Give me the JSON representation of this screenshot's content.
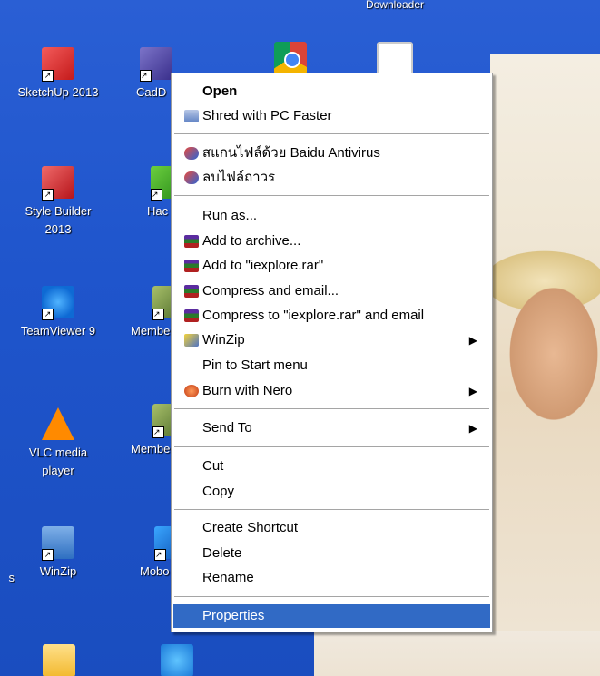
{
  "desktop": {
    "top_label": "Downloader",
    "icons": [
      {
        "label": "SketchUp 2013"
      },
      {
        "label": "CadD"
      },
      {
        "label": "Style Builder 2013"
      },
      {
        "label": "Hac"
      },
      {
        "label": "TeamViewer 9"
      },
      {
        "label": "Membe"
      },
      {
        "label": "VLC media player"
      },
      {
        "label": "Membe"
      },
      {
        "label": "WinZip"
      },
      {
        "label": "Mobo"
      },
      {
        "label": "s"
      }
    ]
  },
  "context_menu": {
    "items": [
      {
        "label": "Open",
        "icon": "none"
      },
      {
        "label": "Shred with PC Faster",
        "icon": "shred-icon"
      },
      {
        "label": "สแกนไฟล์ด้วย Baidu Antivirus",
        "icon": "baidu-antivirus-icon"
      },
      {
        "label": "ลบไฟล์ถาวร",
        "icon": "baidu-antivirus-icon"
      },
      {
        "label": "Run as...",
        "icon": "none"
      },
      {
        "label": "Add to archive...",
        "icon": "winrar-icon"
      },
      {
        "label": "Add to \"iexplore.rar\"",
        "icon": "winrar-icon"
      },
      {
        "label": "Compress and email...",
        "icon": "winrar-icon"
      },
      {
        "label": "Compress to \"iexplore.rar\" and email",
        "icon": "winrar-icon"
      },
      {
        "label": "WinZip",
        "icon": "winzip-icon",
        "submenu": true
      },
      {
        "label": "Pin to Start menu",
        "icon": "none"
      },
      {
        "label": "Burn with Nero",
        "icon": "nero-icon",
        "submenu": true
      },
      {
        "label": "Send To",
        "icon": "none",
        "submenu": true
      },
      {
        "label": "Cut",
        "icon": "none"
      },
      {
        "label": "Copy",
        "icon": "none"
      },
      {
        "label": "Create Shortcut",
        "icon": "none"
      },
      {
        "label": "Delete",
        "icon": "none"
      },
      {
        "label": "Rename",
        "icon": "none"
      },
      {
        "label": "Properties",
        "icon": "none",
        "highlighted": true
      }
    ]
  },
  "colors": {
    "desktop_blue": "#1f55cc",
    "menu_highlight": "#316ac5",
    "menu_background": "#ffffff"
  }
}
